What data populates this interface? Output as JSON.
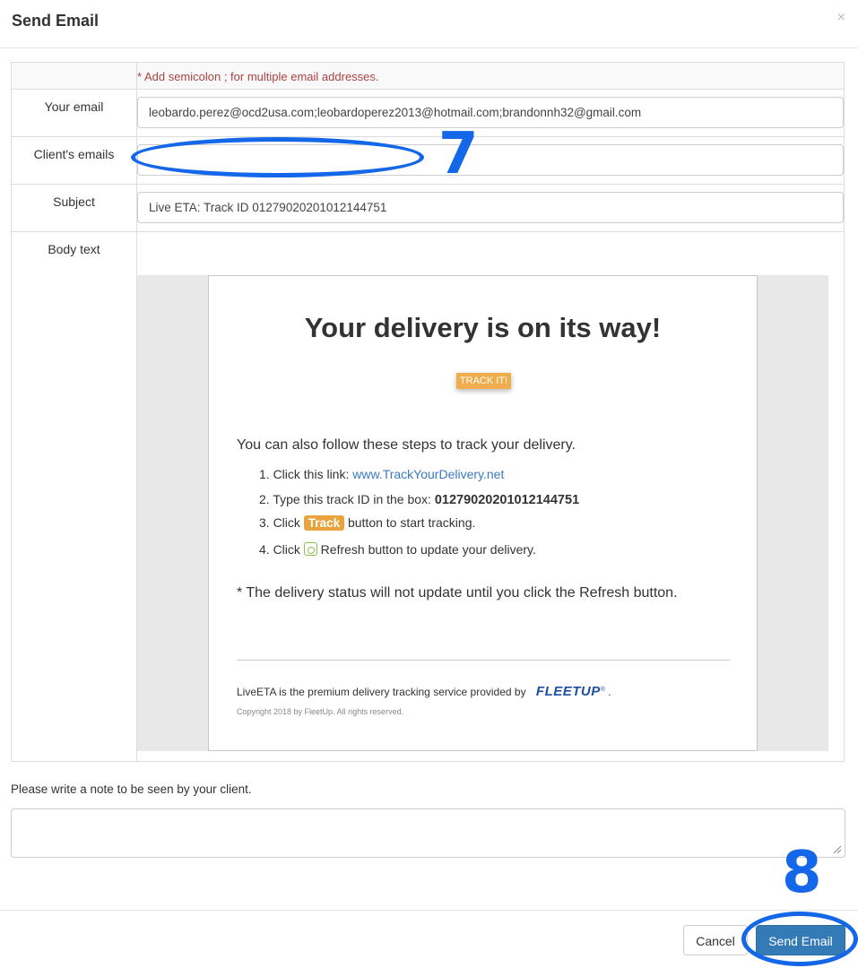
{
  "modal": {
    "title": "Send Email",
    "close_glyph": "×"
  },
  "form": {
    "hint": "* Add semicolon ; for multiple email addresses.",
    "your_email": {
      "label": "Your email",
      "value": "leobardo.perez@ocd2usa.com;leobardoperez2013@hotmail.com;brandonnh32@gmail.com"
    },
    "clients_emails": {
      "label": "Client's emails",
      "value": ""
    },
    "subject": {
      "label": "Subject",
      "value": "Live ETA: Track ID 01279020201012144751"
    },
    "body_text": {
      "label": "Body text"
    }
  },
  "preview": {
    "heading": "Your delivery is on its way!",
    "track_button": "TRACK IT!",
    "intro": "You can also follow these steps to track your delivery.",
    "step1_prefix": "1. Click this link: ",
    "step1_link": "www.TrackYourDelivery.net",
    "step2_prefix": "2. Type this track ID in the box: ",
    "step2_id": "01279020201012144751",
    "step3_prefix": "3. Click ",
    "step3_badge": "Track",
    "step3_suffix": " button to start tracking.",
    "step4_prefix": "4. Click ",
    "step4_suffix": " Refresh button to update your delivery.",
    "note": "* The delivery status will not update until you click the Refresh button.",
    "footer_text": "LiveETA is the premium delivery tracking service provided by ",
    "logo": "FLEETUP",
    "logo_mark": "®",
    "footer_period": " .",
    "copyright": "Copyright 2018 by FleetUp. All rights reserved."
  },
  "note_section": {
    "label": "Please write a note to be seen by your client.",
    "value": ""
  },
  "buttons": {
    "cancel": "Cancel",
    "send": "Send Email"
  },
  "annotations": {
    "step7": "7",
    "step8": "8",
    "color": "#1467e8"
  },
  "colors": {
    "primary": "#337ab7",
    "hint": "#a94442",
    "track_orange": "#f0ad4e",
    "link": "#3b7ac3"
  }
}
